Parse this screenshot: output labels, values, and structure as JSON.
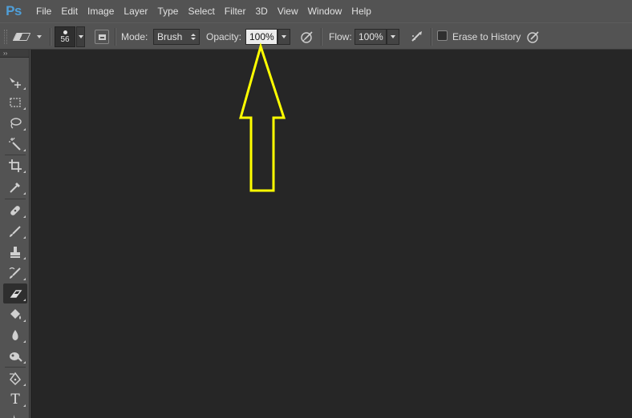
{
  "app": {
    "logo_text": "Ps"
  },
  "menu": {
    "items": [
      "File",
      "Edit",
      "Image",
      "Layer",
      "Type",
      "Select",
      "Filter",
      "3D",
      "View",
      "Window",
      "Help"
    ]
  },
  "options_bar": {
    "brush_size": "56",
    "mode_label": "Mode:",
    "mode_value": "Brush",
    "opacity_label": "Opacity:",
    "opacity_value": "100%",
    "flow_label": "Flow:",
    "flow_value": "100%",
    "erase_to_history_label": "Erase to History",
    "erase_to_history_checked": false
  },
  "toolbox": {
    "collapse_glyph": "››",
    "tools": [
      {
        "name": "move-tool",
        "icon": "move-icon"
      },
      {
        "name": "marquee-tool",
        "icon": "rect-marquee-icon"
      },
      {
        "name": "lasso-tool",
        "icon": "lasso-icon"
      },
      {
        "name": "magic-wand-tool",
        "icon": "magic-wand-icon"
      },
      {
        "name": "crop-tool",
        "icon": "crop-icon"
      },
      {
        "name": "eyedropper-tool",
        "icon": "eyedropper-icon"
      },
      {
        "name": "healing-brush-tool",
        "icon": "bandage-icon"
      },
      {
        "name": "brush-tool",
        "icon": "brush-icon"
      },
      {
        "name": "clone-stamp-tool",
        "icon": "stamp-icon"
      },
      {
        "name": "history-brush-tool",
        "icon": "history-brush-icon"
      },
      {
        "name": "eraser-tool",
        "icon": "eraser-icon",
        "active": true
      },
      {
        "name": "paint-bucket-tool",
        "icon": "paint-bucket-icon"
      },
      {
        "name": "blur-tool",
        "icon": "blur-drop-icon"
      },
      {
        "name": "dodge-tool",
        "icon": "dodge-icon"
      },
      {
        "name": "pen-tool",
        "icon": "pen-icon"
      },
      {
        "name": "type-tool",
        "icon": "type-icon",
        "glyph": "T"
      },
      {
        "name": "path-selection-tool",
        "icon": "path-select-icon"
      }
    ]
  },
  "annotation": {
    "color": "#ffff00",
    "points_to": "opacity-field"
  },
  "colors": {
    "chrome": "#535353",
    "canvas": "#262626",
    "logo": "#4f9fd9"
  }
}
